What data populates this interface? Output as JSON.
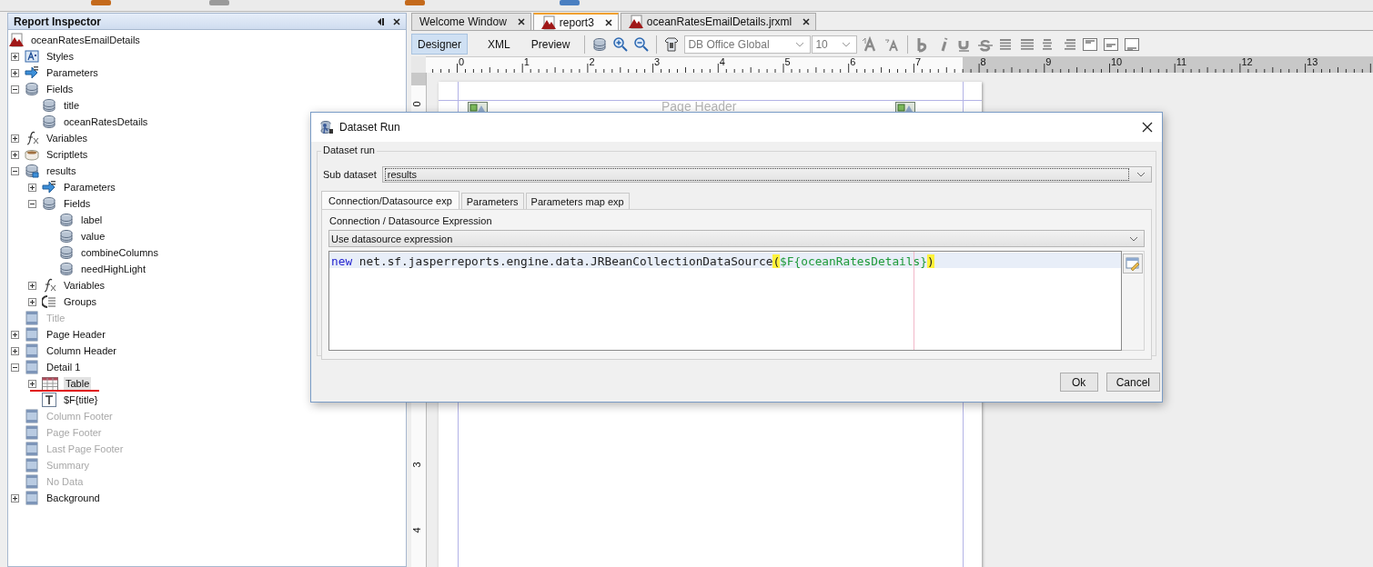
{
  "inspector": {
    "title": "Report Inspector",
    "tree": [
      {
        "label": "oceanRatesEmailDetails",
        "kind": "report",
        "selected": false,
        "disabled": false,
        "underlined": false,
        "children": [
          {
            "label": "Styles",
            "kind": "styles",
            "expanded": false,
            "selected": false,
            "disabled": false,
            "underlined": false
          },
          {
            "label": "Parameters",
            "kind": "parameters",
            "expanded": false,
            "selected": false,
            "disabled": false,
            "underlined": false
          },
          {
            "label": "Fields",
            "kind": "fields",
            "expanded": true,
            "selected": false,
            "disabled": false,
            "underlined": false,
            "children": [
              {
                "label": "title",
                "kind": "field",
                "selected": false,
                "disabled": false,
                "underlined": false
              },
              {
                "label": "oceanRatesDetails",
                "kind": "field",
                "selected": false,
                "disabled": false,
                "underlined": false
              }
            ]
          },
          {
            "label": "Variables",
            "kind": "variables",
            "expanded": false,
            "selected": false,
            "disabled": false,
            "underlined": false
          },
          {
            "label": "Scriptlets",
            "kind": "scriptlets",
            "expanded": false,
            "selected": false,
            "disabled": false,
            "underlined": false
          },
          {
            "label": "results",
            "kind": "dataset",
            "expanded": true,
            "selected": false,
            "disabled": false,
            "underlined": false,
            "children": [
              {
                "label": "Parameters",
                "kind": "parameters",
                "expanded": false,
                "selected": false,
                "disabled": false,
                "underlined": false
              },
              {
                "label": "Fields",
                "kind": "fields",
                "expanded": true,
                "selected": false,
                "disabled": false,
                "underlined": false,
                "children": [
                  {
                    "label": "label",
                    "kind": "field",
                    "selected": false,
                    "disabled": false,
                    "underlined": false
                  },
                  {
                    "label": "value",
                    "kind": "field",
                    "selected": false,
                    "disabled": false,
                    "underlined": false
                  },
                  {
                    "label": "combineColumns",
                    "kind": "field",
                    "selected": false,
                    "disabled": false,
                    "underlined": false
                  },
                  {
                    "label": "needHighLight",
                    "kind": "field",
                    "selected": false,
                    "disabled": false,
                    "underlined": false
                  }
                ]
              },
              {
                "label": "Variables",
                "kind": "variables",
                "expanded": false,
                "selected": false,
                "disabled": false,
                "underlined": false
              },
              {
                "label": "Groups",
                "kind": "groups",
                "expanded": false,
                "selected": false,
                "disabled": false,
                "underlined": false
              }
            ]
          },
          {
            "label": "Title",
            "kind": "band",
            "selected": false,
            "disabled": true,
            "underlined": false
          },
          {
            "label": "Page Header",
            "kind": "band",
            "expanded": false,
            "selected": false,
            "disabled": false,
            "underlined": false
          },
          {
            "label": "Column Header",
            "kind": "band",
            "expanded": false,
            "selected": false,
            "disabled": false,
            "underlined": false
          },
          {
            "label": "Detail 1",
            "kind": "band",
            "expanded": true,
            "selected": false,
            "disabled": false,
            "underlined": false,
            "children": [
              {
                "label": "Table",
                "kind": "table",
                "expanded": false,
                "selected": true,
                "disabled": false,
                "underlined": true
              },
              {
                "label": "$F{title}",
                "kind": "text",
                "selected": false,
                "disabled": false,
                "underlined": false
              }
            ]
          },
          {
            "label": "Column Footer",
            "kind": "band",
            "selected": false,
            "disabled": true,
            "underlined": false
          },
          {
            "label": "Page Footer",
            "kind": "band",
            "selected": false,
            "disabled": true,
            "underlined": false
          },
          {
            "label": "Last Page Footer",
            "kind": "band",
            "selected": false,
            "disabled": true,
            "underlined": false
          },
          {
            "label": "Summary",
            "kind": "band",
            "selected": false,
            "disabled": true,
            "underlined": false
          },
          {
            "label": "No Data",
            "kind": "band",
            "selected": false,
            "disabled": true,
            "underlined": false
          },
          {
            "label": "Background",
            "kind": "band",
            "expanded": false,
            "selected": false,
            "disabled": false,
            "underlined": false
          }
        ]
      }
    ]
  },
  "editor_tabs": [
    {
      "label": "Welcome Window",
      "selected": false,
      "kind": "welcome"
    },
    {
      "label": "report3",
      "selected": true,
      "kind": "report"
    },
    {
      "label": "oceanRatesEmailDetails.jrxml",
      "selected": false,
      "kind": "report"
    }
  ],
  "view_tabs": [
    {
      "label": "Designer",
      "selected": true
    },
    {
      "label": "XML",
      "selected": false
    },
    {
      "label": "Preview",
      "selected": false
    }
  ],
  "font_family": {
    "value": "DB Office Global"
  },
  "font_size": {
    "value": "10"
  },
  "ruler": {
    "labels": [
      "0",
      "1",
      "2",
      "3",
      "4",
      "5",
      "6",
      "7",
      "8",
      "9",
      "10",
      "11",
      "12",
      "13"
    ]
  },
  "vertical_ruler": {
    "segments": [
      {
        "labels": [
          "0"
        ]
      },
      {
        "labels": [
          "3",
          "4"
        ]
      }
    ]
  },
  "page": {
    "band_label": "Page Header"
  },
  "dialog": {
    "title": "Dataset Run",
    "group": "Dataset run",
    "sub_dataset": {
      "label": "Sub dataset",
      "value": "results"
    },
    "tabs": [
      {
        "label": "Connection/Datasource exp",
        "selected": true
      },
      {
        "label": "Parameters",
        "selected": false
      },
      {
        "label": "Parameters map exp",
        "selected": false
      }
    ],
    "expression_label": "Connection / Datasource Expression",
    "expression_type": "Use datasource expression",
    "code": [
      {
        "text": "new",
        "kind": "keyword"
      },
      {
        "text": " net.sf.jasperreports.engine.data.JRBeanCollectionDataSource",
        "kind": "plain"
      },
      {
        "text": "(",
        "kind": "bracket"
      },
      {
        "text": "$F{oceanRatesDetails}",
        "kind": "field"
      },
      {
        "text": ")",
        "kind": "bracket"
      }
    ],
    "buttons": [
      "Ok",
      "Cancel"
    ]
  }
}
